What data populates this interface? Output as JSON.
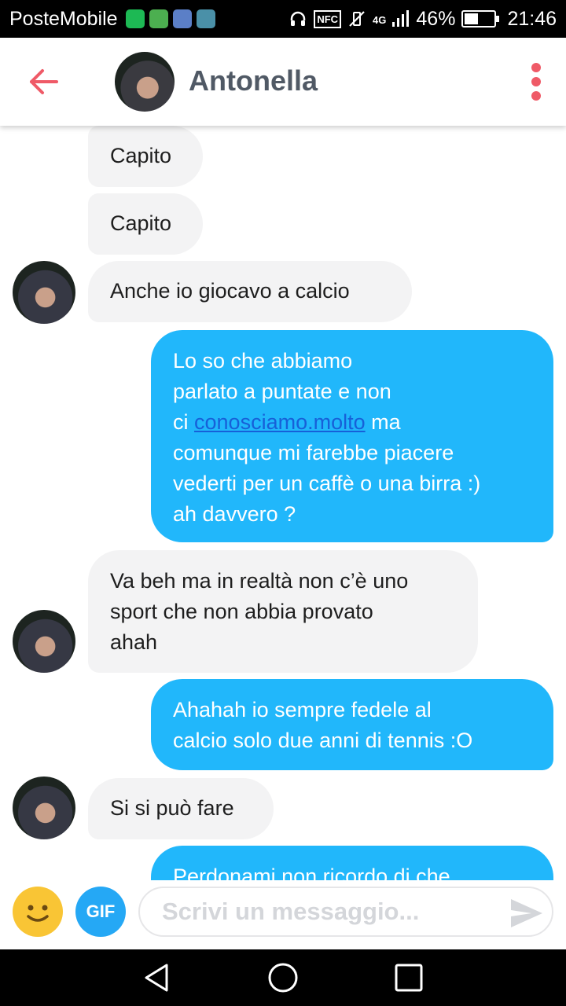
{
  "status_bar": {
    "carrier": "PosteMobile",
    "network": "4G",
    "battery": "46%",
    "battery_level": 0.46,
    "time": "21:46",
    "nfc": "NFC"
  },
  "header": {
    "contact_name": "Antonella",
    "back_icon": "arrow-left-icon",
    "menu_icon": "more-vertical-icon",
    "accent_color": "#ef5a67"
  },
  "messages": [
    {
      "from": "contact",
      "text": "Capito"
    },
    {
      "from": "contact",
      "text": "Capito"
    },
    {
      "from": "contact",
      "text": "Anche io giocavo a calcio"
    },
    {
      "from": "me",
      "lines": [
        "Lo so che abbiamo",
        "parlato a puntate e non",
        "ci",
        "conosciamo.molto",
        "ma",
        "comunque mi farebbe piacere",
        "vederti per un caffè o una birra :)",
        "ah davvero ?"
      ]
    },
    {
      "from": "contact",
      "lines": [
        "Va beh ma in realtà non c’è uno",
        "sport che non abbia provato",
        "ahah"
      ]
    },
    {
      "from": "me",
      "lines": [
        "Ahahah io sempre fedele al",
        "calcio solo due anni di tennis :O"
      ]
    },
    {
      "from": "contact",
      "text": "Si si può fare"
    },
    {
      "from": "me",
      "text": "Perdonami non ricordo di che"
    }
  ],
  "composer": {
    "gif_label": "GIF",
    "placeholder": "Scrivi un messaggio...",
    "emoji_icon": "smiley-icon",
    "send_icon": "send-icon"
  },
  "colors": {
    "incoming_bubble": "#f3f3f4",
    "outgoing_bubble": "#21b7fb",
    "link": "#1760d8"
  }
}
